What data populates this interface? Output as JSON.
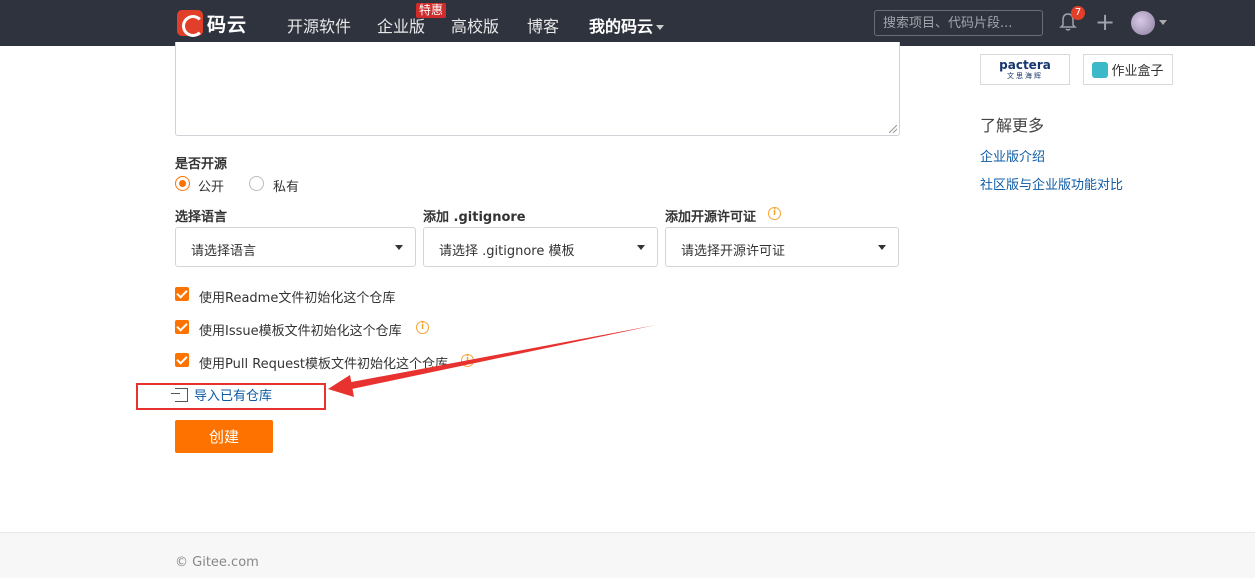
{
  "nav": {
    "logo_text": "码云",
    "items": [
      "开源软件",
      "企业版",
      "高校版",
      "博客",
      "我的码云"
    ],
    "badge": "特惠",
    "search_placeholder": "搜索项目、代码片段...",
    "notification_count": "7",
    "plus": "+"
  },
  "form": {
    "open_source_label": "是否开源",
    "radio_public": "公开",
    "radio_private": "私有",
    "selected_visibility": "公开",
    "language_label": "选择语言",
    "language_select": "请选择语言",
    "gitignore_label": "添加 .gitignore",
    "gitignore_select": "请选择 .gitignore 模板",
    "license_label": "添加开源许可证",
    "license_select": "请选择开源许可证",
    "check_readme": "使用Readme文件初始化这个仓库",
    "check_issue": "使用Issue模板文件初始化这个仓库",
    "check_pr": "使用Pull Request模板文件初始化这个仓库",
    "import_link": "导入已有仓库",
    "create_button": "创建"
  },
  "sidebar": {
    "partner_pactera": "pactera",
    "partner_pactera_sub": "文思海辉",
    "partner_box": "作业盒子",
    "learn_more": "了解更多",
    "links": [
      "企业版介绍",
      "社区版与企业版功能对比"
    ]
  },
  "footer": {
    "copyright": "© Gitee.com"
  },
  "colors": {
    "accent": "#fe7300",
    "nav_bg": "#2f333e",
    "link": "#0e5ba5",
    "annotation": "#e8322f"
  }
}
